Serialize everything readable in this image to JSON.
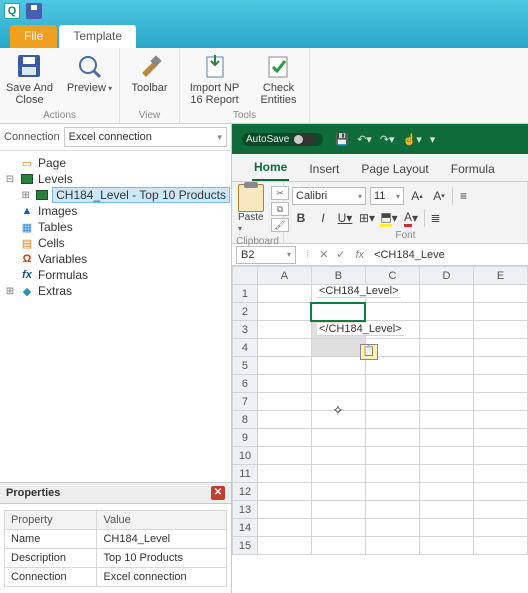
{
  "qa": {
    "app_initial": "Q"
  },
  "tabs": {
    "file": "File",
    "template": "Template"
  },
  "ribbon": {
    "save_close": "Save And Close",
    "preview": "Preview",
    "toolbar": "Toolbar",
    "import": "Import NP 16 Report",
    "check": "Check Entities",
    "grp_actions": "Actions",
    "grp_view": "View",
    "grp_tools": "Tools"
  },
  "connection": {
    "label": "Connection",
    "value": "Excel connection"
  },
  "tree": {
    "page": "Page",
    "levels": "Levels",
    "level_item": "CH184_Level - Top 10 Products",
    "images": "Images",
    "tables": "Tables",
    "cells": "Cells",
    "variables": "Variables",
    "formulas": "Formulas",
    "extras": "Extras"
  },
  "props": {
    "title": "Properties",
    "col_property": "Property",
    "col_value": "Value",
    "rows": [
      {
        "p": "Name",
        "v": "CH184_Level"
      },
      {
        "p": "Description",
        "v": "Top 10 Products"
      },
      {
        "p": "Connection",
        "v": "Excel connection"
      }
    ]
  },
  "excel": {
    "autosave": "AutoSave",
    "tabs": {
      "home": "Home",
      "insert": "Insert",
      "page_layout": "Page Layout",
      "formulas": "Formula"
    },
    "clipboard": {
      "paste": "Paste",
      "label": "Clipboard"
    },
    "font": {
      "name": "Calibri",
      "size": "11",
      "label": "Font"
    },
    "name_box": "B2",
    "fx_label": "fx",
    "fx_value": "<CH184_Leve",
    "cols": [
      "A",
      "B",
      "C",
      "D",
      "E"
    ],
    "rows": [
      "1",
      "2",
      "3",
      "4",
      "5",
      "6",
      "7",
      "8",
      "9",
      "10",
      "11",
      "12",
      "13",
      "14",
      "15"
    ],
    "cell_b2": "<CH184_Level>",
    "cell_b4": "</CH184_Level>"
  }
}
